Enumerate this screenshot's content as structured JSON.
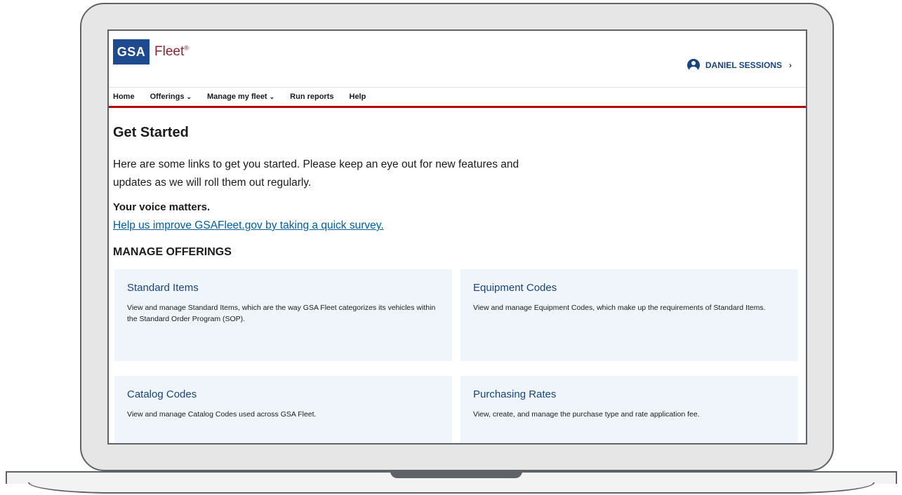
{
  "logo": {
    "box_text": "GSA",
    "word": "Fleet",
    "mark": "®"
  },
  "user": {
    "name": "DANIEL SESSIONS",
    "icon": "user-circle-icon",
    "chevron": "›"
  },
  "nav": {
    "items": [
      {
        "label": "Home",
        "dropdown": false
      },
      {
        "label": "Offerings",
        "dropdown": true
      },
      {
        "label": "Manage my fleet",
        "dropdown": true
      },
      {
        "label": "Run reports",
        "dropdown": false
      },
      {
        "label": "Help",
        "dropdown": false
      }
    ],
    "chevron": "⌄"
  },
  "main": {
    "title": "Get Started",
    "intro": "Here are some links to get you started. Please keep an eye out for new features and updates as we will roll them out regularly.",
    "voice_title": "Your voice matters.",
    "survey_link": "Help us improve GSAFleet.gov by taking a quick survey.",
    "section_title": "MANAGE OFFERINGS",
    "cards": [
      {
        "title": "Standard Items",
        "desc": "View and manage Standard Items, which are the way GSA Fleet categorizes its vehicles within the Standard Order Program (SOP)."
      },
      {
        "title": "Equipment Codes",
        "desc": "View and manage Equipment Codes, which make up the requirements of Standard Items."
      },
      {
        "title": "Catalog Codes",
        "desc": "View and manage Catalog Codes used across GSA Fleet."
      },
      {
        "title": "Purchasing Rates",
        "desc": "View, create, and manage the purchase type and rate application fee."
      }
    ]
  },
  "colors": {
    "brand_blue": "#1e4b8f",
    "link_blue": "#005ea2",
    "accent_red": "#b50909",
    "card_bg": "#eff5fb",
    "fleet_maroon": "#8c2332"
  }
}
